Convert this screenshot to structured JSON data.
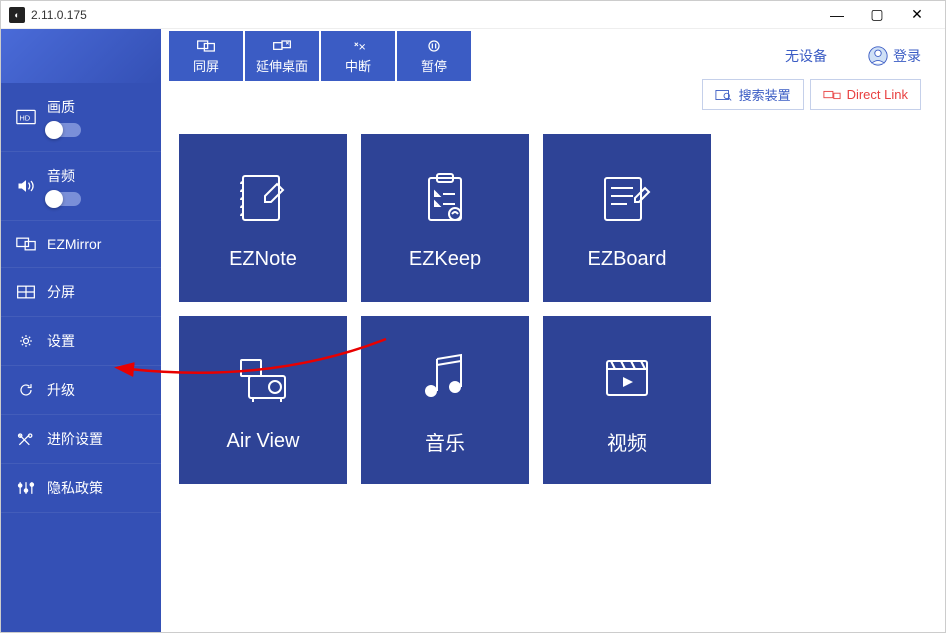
{
  "window": {
    "title": "2.11.0.175"
  },
  "toolbar": {
    "mirror": "同屏",
    "extend": "延伸桌面",
    "disconnect": "中断",
    "pause": "暂停"
  },
  "status": {
    "no_device": "无设备",
    "login": "登录",
    "search_device": "搜索装置",
    "direct_link": "Direct Link"
  },
  "sidebar": {
    "quality": "画质",
    "audio": "音频",
    "ezmirror": "EZMirror",
    "split": "分屏",
    "settings": "设置",
    "upgrade": "升级",
    "advanced": "进阶设置",
    "privacy": "隐私政策"
  },
  "tiles": {
    "eznote": "EZNote",
    "ezkeep": "EZKeep",
    "ezboard": "EZBoard",
    "airview": "Air View",
    "music": "音乐",
    "video": "视频"
  }
}
